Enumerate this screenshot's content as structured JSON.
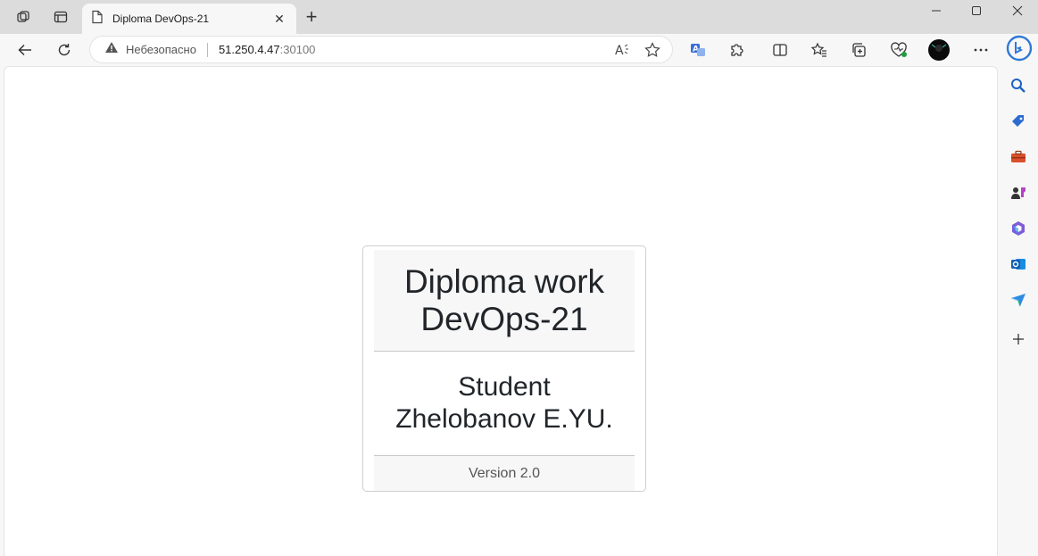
{
  "browser": {
    "tab": {
      "title": "Diploma DevOps-21"
    },
    "address": {
      "security_label": "Небезопасно",
      "host": "51.250.4.47",
      "port": ":30100"
    }
  },
  "page": {
    "header_line1": "Diploma work",
    "header_line2": "DevOps-21",
    "student_line1": "Student",
    "student_line2": "Zhelobanov E.YU.",
    "version": "Version 2.0"
  },
  "icons": {
    "workspaces": "workspaces-icon",
    "tab_actions": "tab-actions-icon",
    "back": "back-arrow-icon",
    "refresh": "refresh-icon",
    "read_aloud": "read-aloud-icon",
    "favorite": "star-icon",
    "translate": "translate-icon",
    "extensions": "puzzle-icon",
    "split_screen": "split-screen-icon",
    "favorites": "favorites-icon",
    "collections": "collections-icon",
    "health": "browser-essentials-icon",
    "profile": "profile-avatar",
    "more": "more-icon",
    "copilot": "bing-icon",
    "search": "search-icon",
    "shopping": "shopping-tag-icon",
    "tools": "toolbox-icon",
    "games": "games-icon",
    "office": "office-icon",
    "outlook": "outlook-icon",
    "send": "drop-icon",
    "add": "plus-icon"
  },
  "colors": {
    "accent": "#0067c0",
    "card_border": "#cfcfcf",
    "card_header_bg": "#f7f7f7"
  }
}
